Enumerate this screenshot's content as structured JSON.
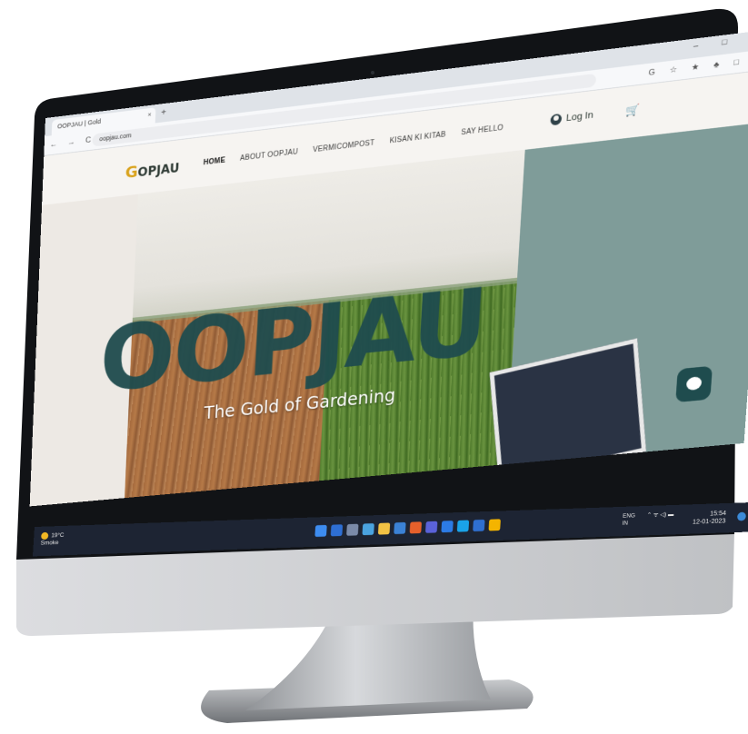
{
  "browser": {
    "tab_title": "OOPJAU | Gold",
    "tab_close": "×",
    "new_tab": "+",
    "window_controls": "–  □  ×",
    "nav_buttons": "← → C",
    "url": "oopjau.com",
    "extension_icons": "G ☆ ★ ♣ □"
  },
  "site": {
    "logo_mark": "G",
    "logo_text": "OPJAU",
    "nav": [
      {
        "label": "HOME",
        "active": true
      },
      {
        "label": "ABOUT OOPJAU",
        "active": false
      },
      {
        "label": "VERMICOMPOST",
        "active": false
      },
      {
        "label": "KISAN KI KITAB",
        "active": false
      },
      {
        "label": "SAY HELLO",
        "active": false
      }
    ],
    "login_label": "Log In",
    "cart_icon": "cart-icon",
    "cart_glyph": "🛒"
  },
  "hero": {
    "title": "OOPJAU",
    "subtitle": "The Gold of Gardening"
  },
  "taskbar": {
    "weather_temp": "19°C",
    "weather_label": "Smoke",
    "lang_line1": "ENG",
    "lang_line2": "IN",
    "sys_icons": "⌃  ᯤ  ◁)  ▬",
    "time": "15:54",
    "date": "12-01-2023",
    "app_colors": [
      "#3d8cf0",
      "#2e6fd4",
      "#7a8aa8",
      "#4aa3df",
      "#f2c244",
      "#3b82d6",
      "#e5602b",
      "#5a62d9",
      "#2c7be5",
      "#1aa3e8",
      "#2f6fd0",
      "#f4b400"
    ]
  },
  "colors": {
    "brand_green": "#1f4c4e",
    "panel_teal": "#7f9c99",
    "taskbar": "#1d2433",
    "accent_gold": "#d9a21b"
  }
}
